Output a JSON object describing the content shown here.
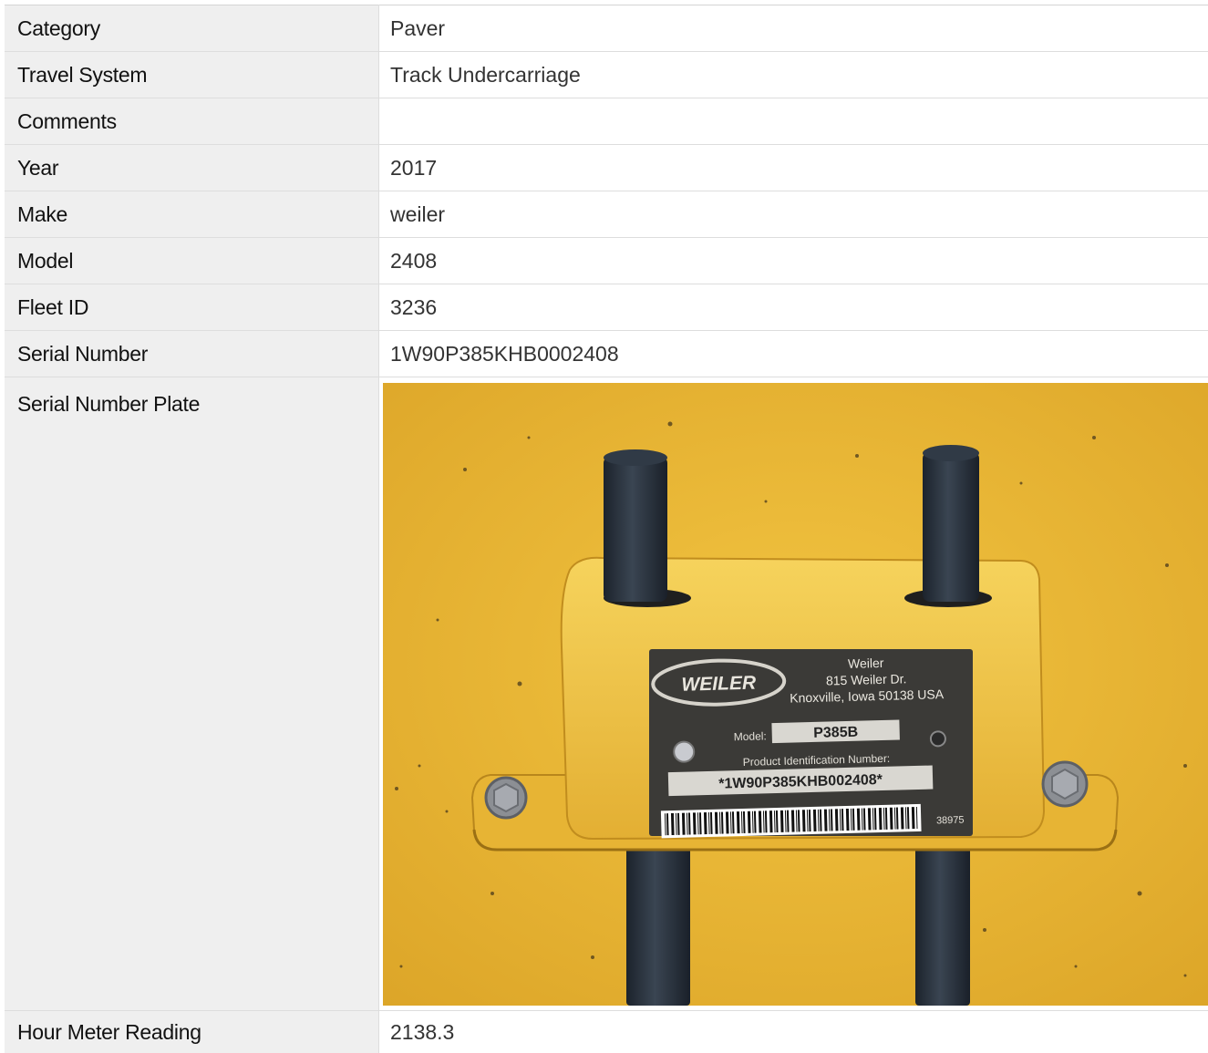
{
  "rows": [
    {
      "label": "Category",
      "value": "Paver"
    },
    {
      "label": "Travel System",
      "value": "Track Undercarriage"
    },
    {
      "label": "Comments",
      "value": ""
    },
    {
      "label": "Year",
      "value": "2017"
    },
    {
      "label": "Make",
      "value": "weiler"
    },
    {
      "label": "Model",
      "value": "2408"
    },
    {
      "label": "Fleet ID",
      "value": "3236"
    },
    {
      "label": "Serial Number",
      "value": "1W90P385KHB0002408"
    }
  ],
  "plate_row": {
    "label": "Serial Number Plate",
    "plate": {
      "brand": "WEILER",
      "company": "Weiler",
      "address1": "815 Weiler Dr.",
      "address2": "Knoxville, Iowa 50138 USA",
      "model_label": "Model:",
      "model_value": "P385B",
      "pin_label": "Product Identification Number:",
      "pin_value": "*1W90P385KHB002408*",
      "barcode_number": "38975"
    },
    "colors": {
      "paint": "#e9b62f",
      "post": "#2b3541",
      "plate": "#3b3a37"
    }
  },
  "last_row": {
    "label": "Hour Meter Reading",
    "value": "2138.3"
  }
}
